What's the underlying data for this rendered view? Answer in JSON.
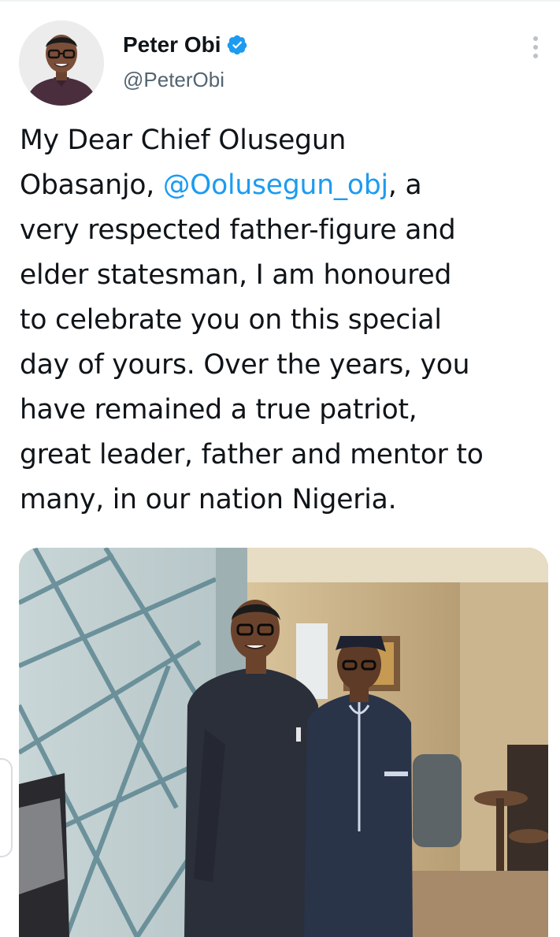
{
  "author": {
    "display_name": "Peter Obi",
    "handle": "@PeterObi",
    "verified": true,
    "avatar_icon": "profile-photo"
  },
  "tweet": {
    "lines": [
      {
        "pre": "My Dear Chief Olusegun"
      },
      {
        "pre": "Obasanjo, ",
        "mention": "@Oolusegun_obj",
        "post": ", a"
      },
      {
        "pre": "very respected father-figure and"
      },
      {
        "pre": "elder statesman, I am honoured"
      },
      {
        "pre": "to celebrate you on this special"
      },
      {
        "pre": "day of yours. Over the years, you"
      },
      {
        "pre": "have remained a true patriot,"
      },
      {
        "pre": "great leader, father and mentor to"
      },
      {
        "pre": "many, in our nation Nigeria."
      }
    ]
  },
  "media": {
    "type": "photo",
    "icon": "photo-two-men-standing"
  },
  "colors": {
    "accent": "#1d9bf0",
    "text": "#0f1419",
    "secondary": "#536471",
    "verified_badge": "#1d9bf0"
  },
  "icons": {
    "verified": "verified-badge-icon",
    "more": "more-vertical-icon"
  }
}
